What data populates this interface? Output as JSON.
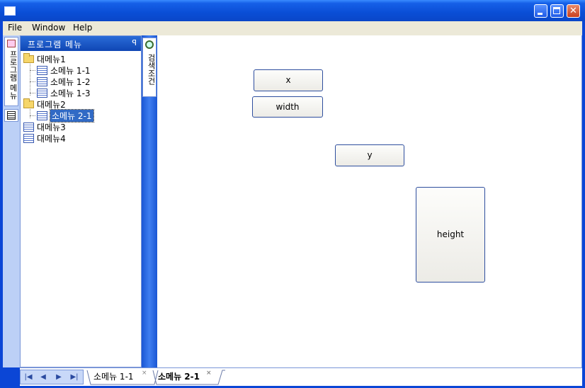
{
  "window": {
    "title": ""
  },
  "menu": [
    "File",
    "Window",
    "Help"
  ],
  "left_strip": {
    "program_menu_tab": "프로그램 메뉴"
  },
  "panel": {
    "title": "프로그램 메뉴",
    "pin": "Ꭴ",
    "tree": [
      {
        "label": "대메뉴1",
        "type": "folder",
        "level": 0
      },
      {
        "label": "소메뉴 1-1",
        "type": "doc",
        "level": 1
      },
      {
        "label": "소메뉴 1-2",
        "type": "doc",
        "level": 1
      },
      {
        "label": "소메뉴 1-3",
        "type": "doc",
        "level": 1
      },
      {
        "label": "대메뉴2",
        "type": "folder",
        "level": 0
      },
      {
        "label": "소메뉴 2-1",
        "type": "doc",
        "level": 1,
        "selected": true
      },
      {
        "label": "대메뉴3",
        "type": "doc",
        "level": 0
      },
      {
        "label": "대메뉴4",
        "type": "doc",
        "level": 0
      }
    ]
  },
  "search_tab": {
    "label": "검색조건"
  },
  "content": {
    "buttons": {
      "x": "x",
      "width": "width",
      "y": "y",
      "height": "height"
    }
  },
  "bottom": {
    "nav": [
      "|◀",
      "◀",
      "▶",
      "▶|"
    ],
    "tabs": [
      {
        "label": "소메뉴 1-1",
        "active": false
      },
      {
        "label": "소메뉴 2-1",
        "active": true
      }
    ],
    "close_glyph": "×"
  }
}
